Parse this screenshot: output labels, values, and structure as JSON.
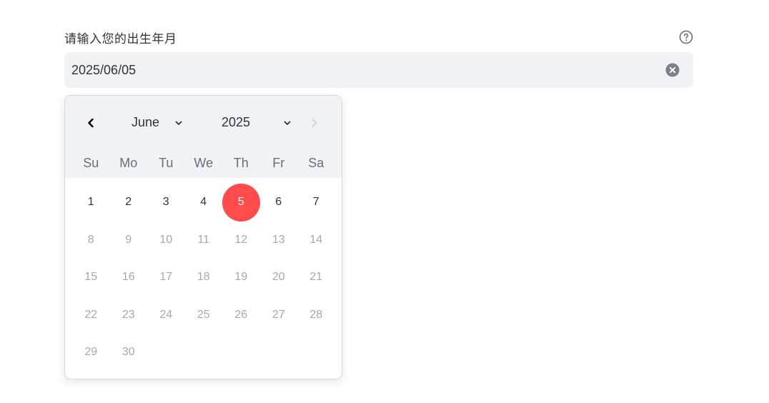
{
  "field": {
    "label": "请输入您的出生年月",
    "value": "2025/06/05",
    "help_icon": "question-circle-icon",
    "clear_icon": "clear-circle-icon"
  },
  "calendar": {
    "month": "June",
    "year": "2025",
    "prev_icon": "chevron-left-icon",
    "next_icon": "chevron-right-icon",
    "next_disabled": true,
    "weekdays": [
      "Su",
      "Mo",
      "Tu",
      "We",
      "Th",
      "Fr",
      "Sa"
    ],
    "days": [
      {
        "label": "1",
        "state": "active"
      },
      {
        "label": "2",
        "state": "active"
      },
      {
        "label": "3",
        "state": "active"
      },
      {
        "label": "4",
        "state": "active"
      },
      {
        "label": "5",
        "state": "selected"
      },
      {
        "label": "6",
        "state": "active"
      },
      {
        "label": "7",
        "state": "active"
      },
      {
        "label": "8",
        "state": "disabled"
      },
      {
        "label": "9",
        "state": "disabled"
      },
      {
        "label": "10",
        "state": "disabled"
      },
      {
        "label": "11",
        "state": "disabled"
      },
      {
        "label": "12",
        "state": "disabled"
      },
      {
        "label": "13",
        "state": "disabled"
      },
      {
        "label": "14",
        "state": "disabled"
      },
      {
        "label": "15",
        "state": "disabled"
      },
      {
        "label": "16",
        "state": "disabled"
      },
      {
        "label": "17",
        "state": "disabled"
      },
      {
        "label": "18",
        "state": "disabled"
      },
      {
        "label": "19",
        "state": "disabled"
      },
      {
        "label": "20",
        "state": "disabled"
      },
      {
        "label": "21",
        "state": "disabled"
      },
      {
        "label": "22",
        "state": "disabled"
      },
      {
        "label": "23",
        "state": "disabled"
      },
      {
        "label": "24",
        "state": "disabled"
      },
      {
        "label": "25",
        "state": "disabled"
      },
      {
        "label": "26",
        "state": "disabled"
      },
      {
        "label": "27",
        "state": "disabled"
      },
      {
        "label": "28",
        "state": "disabled"
      },
      {
        "label": "29",
        "state": "disabled"
      },
      {
        "label": "30",
        "state": "disabled"
      }
    ]
  },
  "colors": {
    "accent": "#ff4b4b",
    "input_bg": "#f0f2f6",
    "text": "#31333f",
    "muted": "#a3a8b4"
  }
}
